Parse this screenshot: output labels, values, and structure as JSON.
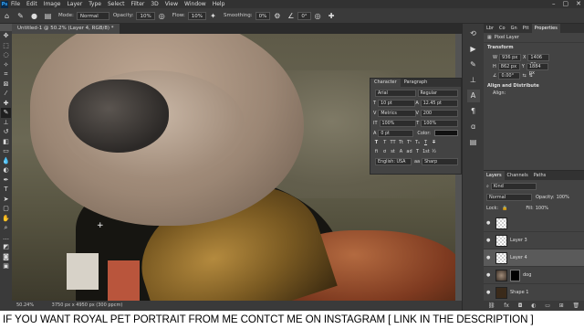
{
  "menubar": {
    "items": [
      "File",
      "Edit",
      "Image",
      "Layer",
      "Type",
      "Select",
      "Filter",
      "3D",
      "View",
      "Window",
      "Help"
    ]
  },
  "options": {
    "mode_label": "Mode:",
    "mode_value": "Normal",
    "opacity_label": "Opacity:",
    "opacity_value": "10%",
    "flow_label": "Flow:",
    "flow_value": "10%",
    "smoothing_label": "Smoothing:",
    "smoothing_value": "0%",
    "angle_value": "0°"
  },
  "document": {
    "tab_title": "Untitled-1 @ 50.2% (Layer 4, RGB/8) *"
  },
  "status": {
    "zoom": "50.24%",
    "size": "3750 px x 4950 px (300 ppcm)"
  },
  "character": {
    "tab1": "Character",
    "tab2": "Paragraph",
    "font": "Arial",
    "style": "Regular",
    "size": "10 pt",
    "leading": "12.45 pt",
    "kerning": "Metrics",
    "tracking": "200",
    "vscale": "100%",
    "hscale": "100%",
    "baseline": "0 pt",
    "color_label": "Color:",
    "glyphs": [
      "T",
      "T",
      "TT",
      "Tt",
      "T¹",
      "T₁",
      "T",
      "T"
    ],
    "glyphs2": [
      "fi",
      "ơ",
      "st",
      "A",
      "ad",
      "T",
      "1st",
      "½"
    ],
    "language": "English: USA",
    "aa": "Sharp"
  },
  "properties": {
    "tabs": [
      "Lbr",
      "Co",
      "Gn",
      "Ptt",
      "Properties"
    ],
    "sub": "Pixel Layer",
    "transform": "Transform",
    "w": "936 px",
    "x": "1406 px",
    "h": "862 px",
    "y": "1884 px",
    "angle": "0.00°",
    "align": "Align and Distribute",
    "align_sub": "Align:"
  },
  "layers_panel": {
    "tabs": [
      "Layers",
      "Channels",
      "Paths"
    ],
    "kind": "Kind",
    "blend": "Normal",
    "opacity_label": "Opacity:",
    "opacity": "100%",
    "lock_label": "Lock:",
    "fill_label": "Fill:",
    "fill": "100%",
    "layers": [
      {
        "name": "",
        "selected": false
      },
      {
        "name": "Layer 3",
        "selected": false
      },
      {
        "name": "Layer 4",
        "selected": true
      },
      {
        "name": "dog",
        "selected": false
      },
      {
        "name": "Shape 1",
        "selected": false
      }
    ]
  },
  "caption": {
    "text": "IF YOU WANT ROYAL PET PORTRAIT FROM ME CONTCT ME ON INSTAGRAM  [ LINK IN THE DESCRIPTION ]"
  }
}
